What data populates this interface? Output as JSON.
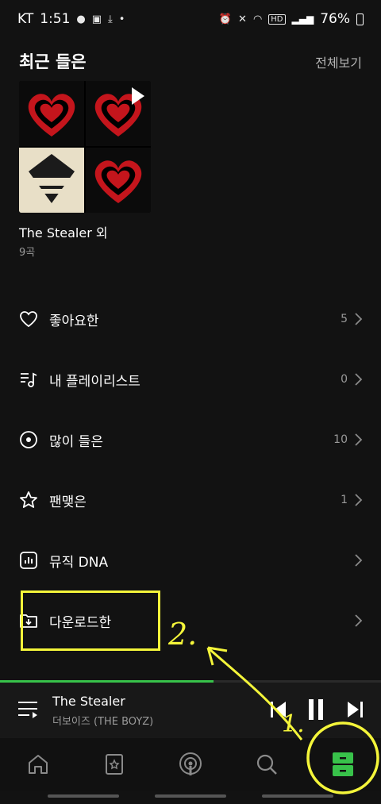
{
  "status_bar": {
    "carrier": "KT",
    "time": "1:51",
    "battery": "76%",
    "hd": "HD"
  },
  "recent": {
    "title": "최근 들은",
    "see_all": "전체보기",
    "album_title": "The Stealer 외",
    "album_sub": "9곡"
  },
  "menu": [
    {
      "label": "좋아요한",
      "count": "5",
      "icon": "heart-icon"
    },
    {
      "label": "내 플레이리스트",
      "count": "0",
      "icon": "playlist-icon"
    },
    {
      "label": "많이 들은",
      "count": "10",
      "icon": "disc-icon"
    },
    {
      "label": "팬맺은",
      "count": "1",
      "icon": "star-icon"
    },
    {
      "label": "뮤직 DNA",
      "count": "",
      "icon": "chart-icon"
    },
    {
      "label": "다운로드한",
      "count": "",
      "icon": "download-folder-icon"
    }
  ],
  "now_playing": {
    "title": "The Stealer",
    "artist": "더보이즈 (THE BOYZ)",
    "progress": 0.56
  },
  "annotations": {
    "label_1": "1.",
    "label_2": "2.",
    "color": "#f4f53a"
  },
  "accent_color": "#38c24a"
}
